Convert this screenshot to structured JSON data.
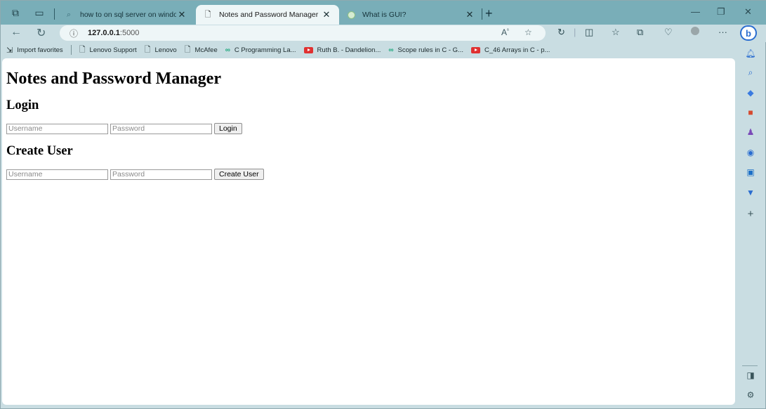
{
  "browser": {
    "tabs": [
      {
        "title": "how to on sql server on windows",
        "icon": "search-icon",
        "active": false
      },
      {
        "title": "Notes and Password Manager",
        "icon": "page-icon",
        "active": true
      },
      {
        "title": "What is GUI?",
        "icon": "globe-icon",
        "active": false
      }
    ],
    "address": {
      "host": "127.0.0.1",
      "port": ":5000"
    },
    "bookmarks": [
      {
        "label": "Import favorites",
        "icon": "import-icon"
      },
      {
        "label": "Lenovo Support",
        "icon": "page-icon"
      },
      {
        "label": "Lenovo",
        "icon": "page-icon"
      },
      {
        "label": "McAfee",
        "icon": "page-icon"
      },
      {
        "label": "C Programming La...",
        "icon": "link-icon"
      },
      {
        "label": "Ruth B. - Dandelion...",
        "icon": "youtube-icon"
      },
      {
        "label": "Scope rules in C - G...",
        "icon": "link-icon"
      },
      {
        "label": "C_46 Arrays in C - p...",
        "icon": "youtube-icon"
      }
    ]
  },
  "page": {
    "title": "Notes and Password Manager",
    "login": {
      "heading": "Login",
      "username_placeholder": "Username",
      "password_placeholder": "Password",
      "button": "Login"
    },
    "create": {
      "heading": "Create User",
      "username_placeholder": "Username",
      "password_placeholder": "Password",
      "button": "Create User"
    }
  }
}
